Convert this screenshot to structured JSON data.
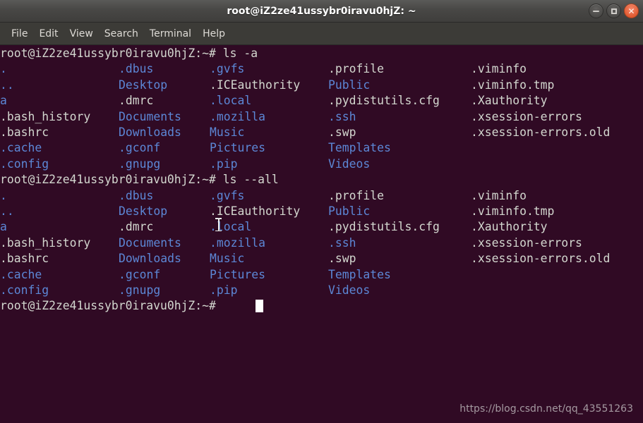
{
  "window": {
    "title": "root@iZ2ze41ussybr0iravu0hjZ: ~",
    "buttons": {
      "minimize": "minimize",
      "maximize": "maximize",
      "close": "close"
    }
  },
  "menubar": {
    "items": [
      {
        "label": "File"
      },
      {
        "label": "Edit"
      },
      {
        "label": "View"
      },
      {
        "label": "Search"
      },
      {
        "label": "Terminal"
      },
      {
        "label": "Help"
      }
    ]
  },
  "terminal": {
    "colors": {
      "background": "#300a24",
      "foreground": "#d3d7cf",
      "directory": "#5c87d6",
      "cursor": "#ffffff"
    },
    "prompt": "root@iZ2ze41ussybr0iravu0hjZ:~# ",
    "blocks": [
      {
        "command": "ls -a",
        "columns": [
          [
            {
              "text": ".",
              "type": "dir"
            },
            {
              "text": "..",
              "type": "dir"
            },
            {
              "text": "a",
              "type": "dir"
            },
            {
              "text": ".bash_history",
              "type": "file"
            },
            {
              "text": ".bashrc",
              "type": "file"
            },
            {
              "text": ".cache",
              "type": "dir"
            },
            {
              "text": ".config",
              "type": "dir"
            }
          ],
          [
            {
              "text": ".dbus",
              "type": "dir"
            },
            {
              "text": "Desktop",
              "type": "dir"
            },
            {
              "text": ".dmrc",
              "type": "file"
            },
            {
              "text": "Documents",
              "type": "dir"
            },
            {
              "text": "Downloads",
              "type": "dir"
            },
            {
              "text": ".gconf",
              "type": "dir"
            },
            {
              "text": ".gnupg",
              "type": "dir"
            }
          ],
          [
            {
              "text": ".gvfs",
              "type": "dir"
            },
            {
              "text": ".ICEauthority",
              "type": "file"
            },
            {
              "text": ".local",
              "type": "dir"
            },
            {
              "text": ".mozilla",
              "type": "dir"
            },
            {
              "text": "Music",
              "type": "dir"
            },
            {
              "text": "Pictures",
              "type": "dir"
            },
            {
              "text": ".pip",
              "type": "dir"
            }
          ],
          [
            {
              "text": ".profile",
              "type": "file"
            },
            {
              "text": "Public",
              "type": "dir"
            },
            {
              "text": ".pydistutils.cfg",
              "type": "file"
            },
            {
              "text": ".ssh",
              "type": "dir"
            },
            {
              "text": ".swp",
              "type": "file"
            },
            {
              "text": "Templates",
              "type": "dir"
            },
            {
              "text": "Videos",
              "type": "dir"
            }
          ],
          [
            {
              "text": ".viminfo",
              "type": "file"
            },
            {
              "text": ".viminfo.tmp",
              "type": "file"
            },
            {
              "text": ".Xauthority",
              "type": "file"
            },
            {
              "text": ".xsession-errors",
              "type": "file"
            },
            {
              "text": ".xsession-errors.old",
              "type": "file"
            }
          ]
        ]
      },
      {
        "command": "ls --all",
        "columns": [
          [
            {
              "text": ".",
              "type": "dir"
            },
            {
              "text": "..",
              "type": "dir"
            },
            {
              "text": "a",
              "type": "dir"
            },
            {
              "text": ".bash_history",
              "type": "file"
            },
            {
              "text": ".bashrc",
              "type": "file"
            },
            {
              "text": ".cache",
              "type": "dir"
            },
            {
              "text": ".config",
              "type": "dir"
            }
          ],
          [
            {
              "text": ".dbus",
              "type": "dir"
            },
            {
              "text": "Desktop",
              "type": "dir"
            },
            {
              "text": ".dmrc",
              "type": "file"
            },
            {
              "text": "Documents",
              "type": "dir"
            },
            {
              "text": "Downloads",
              "type": "dir"
            },
            {
              "text": ".gconf",
              "type": "dir"
            },
            {
              "text": ".gnupg",
              "type": "dir"
            }
          ],
          [
            {
              "text": ".gvfs",
              "type": "dir"
            },
            {
              "text": ".ICEauthority",
              "type": "file"
            },
            {
              "text": ".local",
              "type": "dir"
            },
            {
              "text": ".mozilla",
              "type": "dir"
            },
            {
              "text": "Music",
              "type": "dir"
            },
            {
              "text": "Pictures",
              "type": "dir"
            },
            {
              "text": ".pip",
              "type": "dir"
            }
          ],
          [
            {
              "text": ".profile",
              "type": "file"
            },
            {
              "text": "Public",
              "type": "dir"
            },
            {
              "text": ".pydistutils.cfg",
              "type": "file"
            },
            {
              "text": ".ssh",
              "type": "dir"
            },
            {
              "text": ".swp",
              "type": "file"
            },
            {
              "text": "Templates",
              "type": "dir"
            },
            {
              "text": "Videos",
              "type": "dir"
            }
          ],
          [
            {
              "text": ".viminfo",
              "type": "file"
            },
            {
              "text": ".viminfo.tmp",
              "type": "file"
            },
            {
              "text": ".Xauthority",
              "type": "file"
            },
            {
              "text": ".xsession-errors",
              "type": "file"
            },
            {
              "text": ".xsession-errors.old",
              "type": "file"
            }
          ]
        ]
      }
    ],
    "final_prompt": "root@iZ2ze41ussybr0iravu0hjZ:~# "
  },
  "watermark": {
    "text": "https://blog.csdn.net/qq_43551263"
  }
}
